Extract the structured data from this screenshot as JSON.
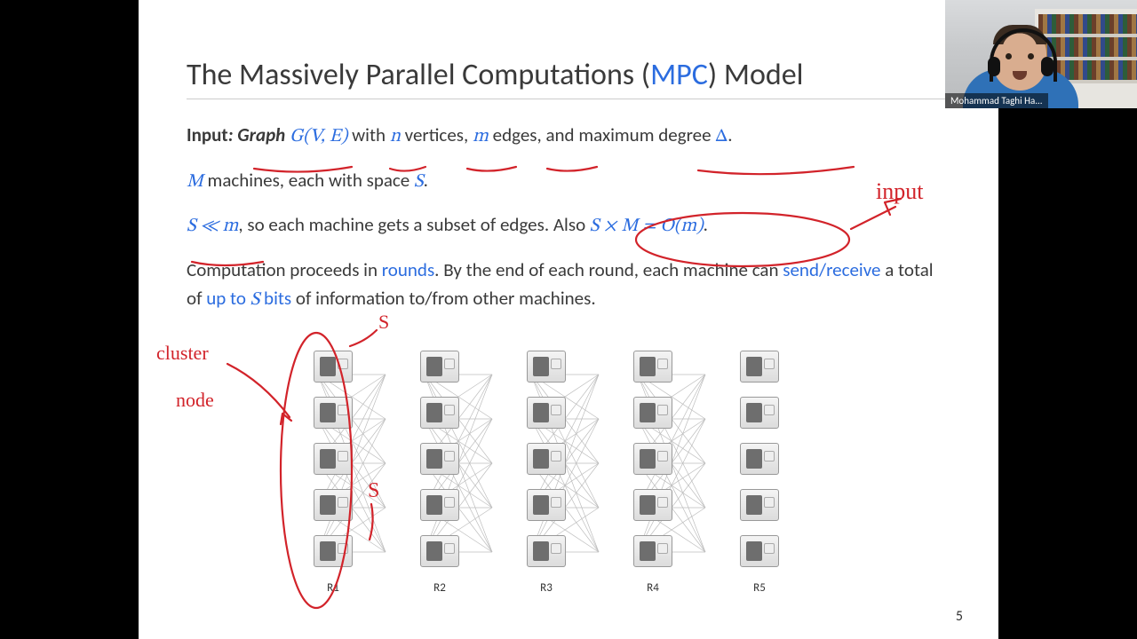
{
  "title": {
    "pre": "The Massively Parallel Computations (",
    "em": "MPC",
    "post": ") Model"
  },
  "line1": {
    "t1": "Input",
    "t2": ": Graph ",
    "g": "G(V, E)",
    "t3": " with ",
    "n": "n",
    "t4": " vertices, ",
    "m": "m",
    "t5": " edges, and maximum degree ",
    "delta": "Δ",
    "dot": "."
  },
  "line2": {
    "M": "M",
    "t1": " machines, each with space ",
    "S": "S",
    "dot": "."
  },
  "line3": {
    "rel": "S ≪ m",
    "t1": ", so each machine gets a subset of edges. Also ",
    "sm": "S × M = O(m)",
    "dot": "."
  },
  "line4": {
    "t1": "Computation proceeds in ",
    "rounds": "rounds",
    "t2": ". By the end of each round, each machine can ",
    "sr": "send/receive",
    "t3": " a total of ",
    "us": "up to ",
    "S": "S",
    "us2": " bits",
    "t4": " of information to/from other machines."
  },
  "columns": [
    "R1",
    "R2",
    "R3",
    "R4",
    "R5"
  ],
  "annotations": {
    "cluster": "cluster",
    "node": "node",
    "input": "input",
    "s_label": "S"
  },
  "pagenum": "5",
  "webcam_name": "Mohammad Taghi Ha..."
}
